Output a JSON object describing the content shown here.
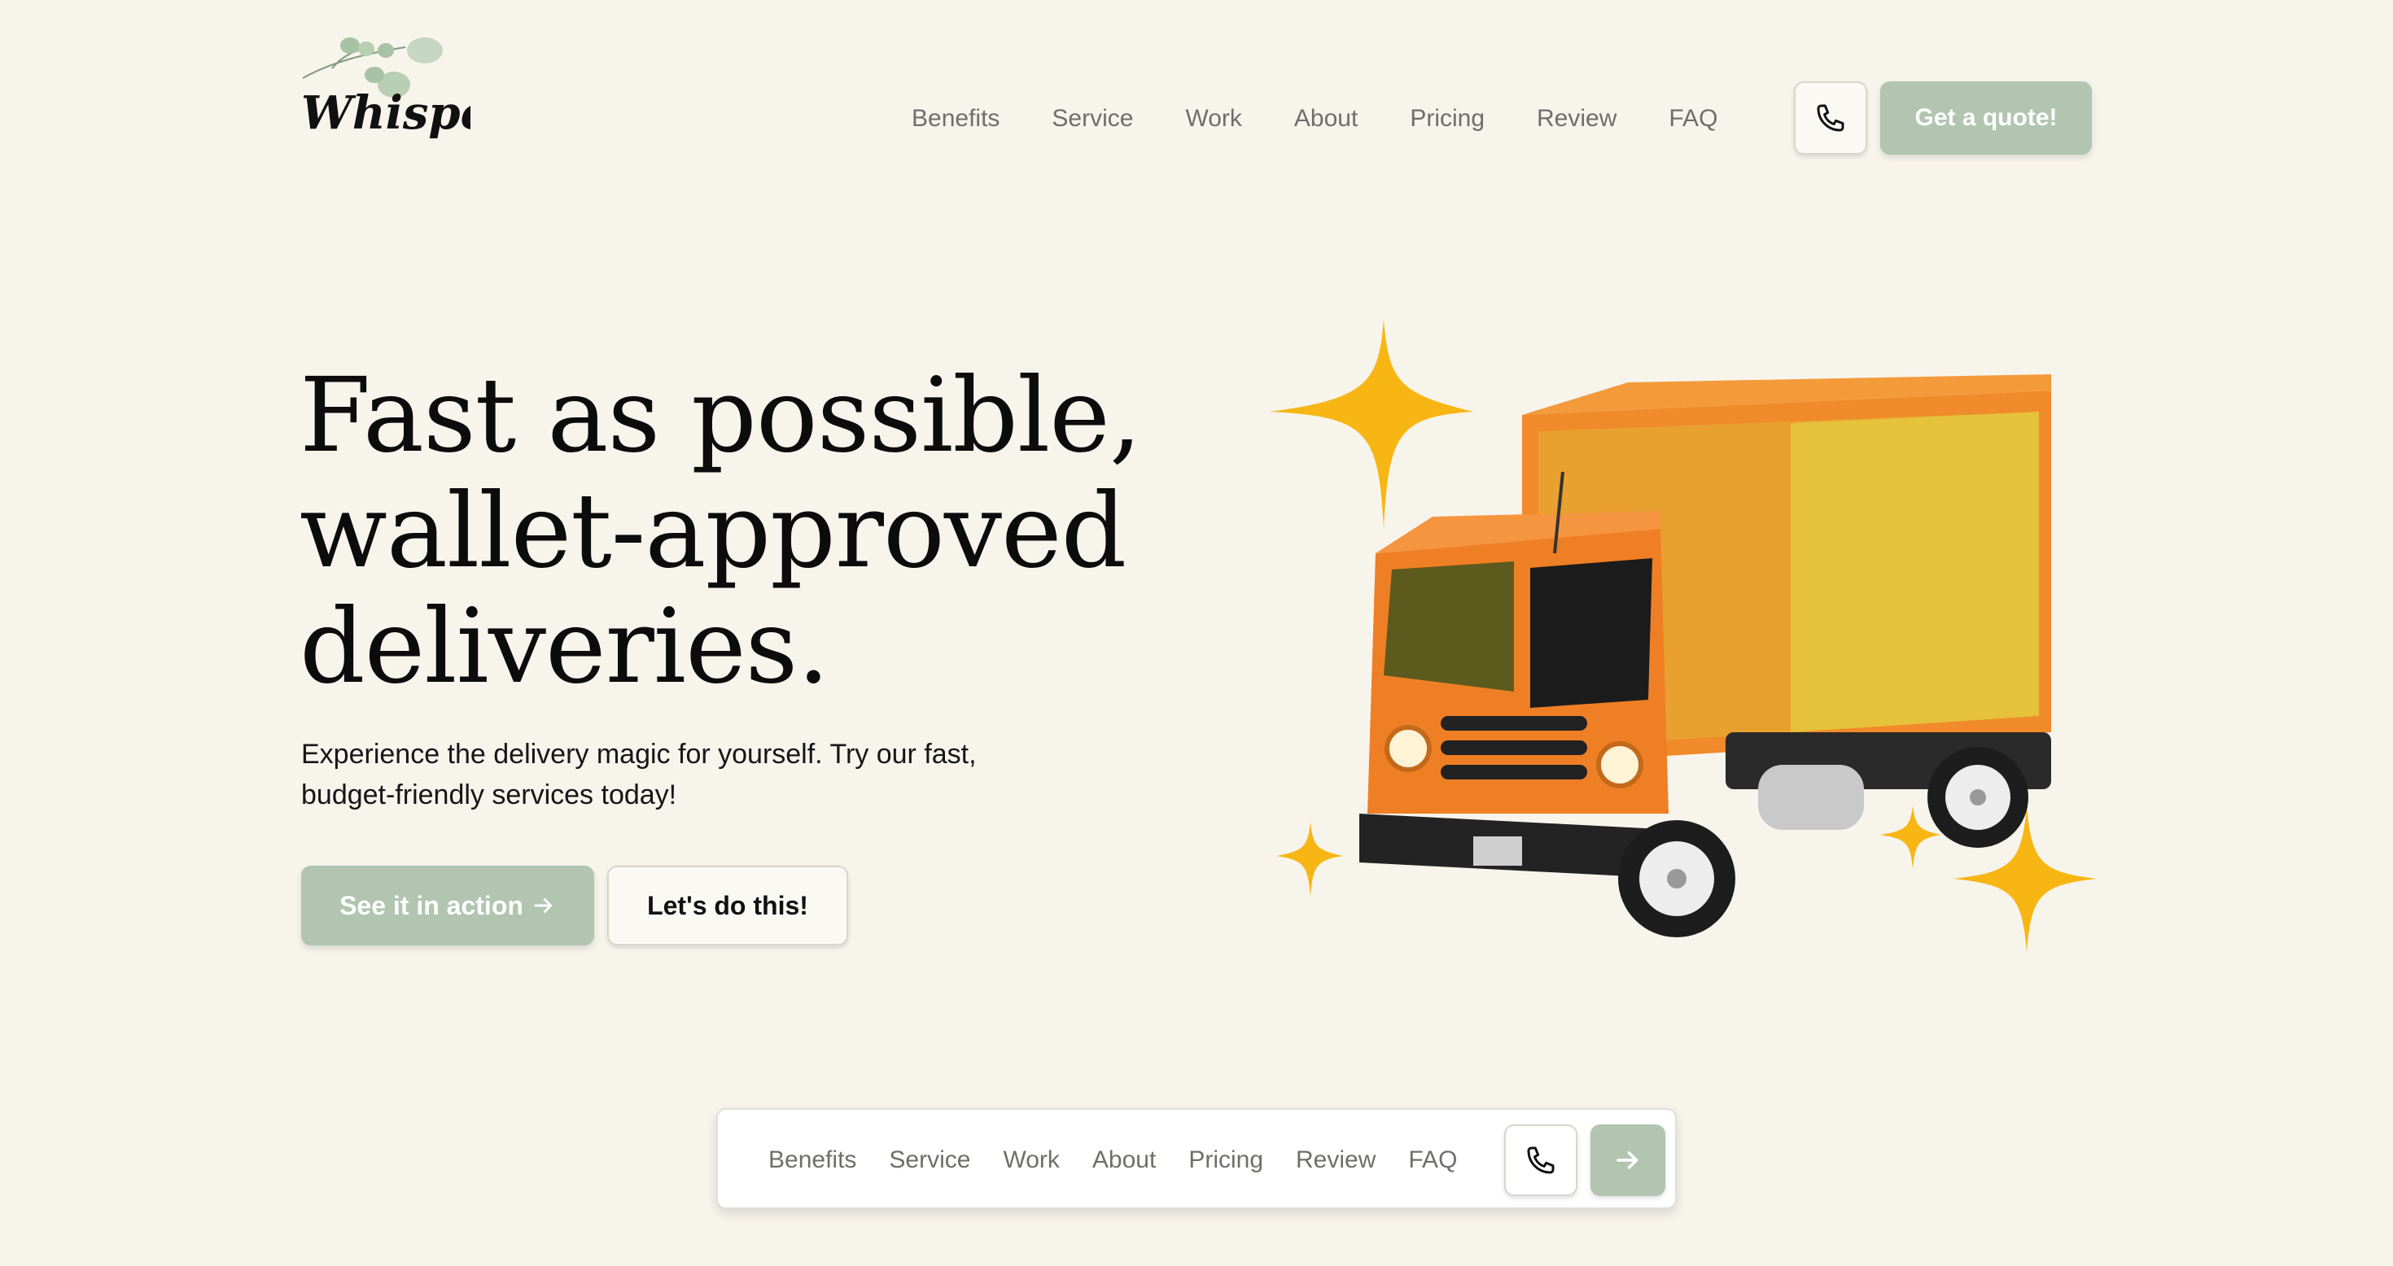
{
  "header": {
    "logo_text": "Whisper",
    "nav": [
      "Benefits",
      "Service",
      "Work",
      "About",
      "Pricing",
      "Review",
      "FAQ"
    ],
    "phone_icon": "phone-icon",
    "cta_label": "Get a quote!"
  },
  "hero": {
    "title_lines": [
      "Fast as possible,",
      "wallet-approved",
      "deliveries."
    ],
    "subtitle_lines": [
      "Experience the delivery magic for yourself. Try our fast,",
      "budget-friendly services today!"
    ],
    "primary_button": "See it in action",
    "primary_button_icon": "arrow-right-icon",
    "secondary_button": "Let's do this!",
    "illustration": "delivery-truck-icon"
  },
  "floating_nav": {
    "items": [
      "Benefits",
      "Service",
      "Work",
      "About",
      "Pricing",
      "Review",
      "FAQ"
    ],
    "phone_icon": "phone-icon",
    "arrow_icon": "arrow-right-icon"
  },
  "colors": {
    "background": "#f7f4ec",
    "accent": "#b1c5b0",
    "truck_orange": "#ee7d22",
    "truck_yellow": "#e6c13a",
    "sparkle": "#f8b614"
  }
}
